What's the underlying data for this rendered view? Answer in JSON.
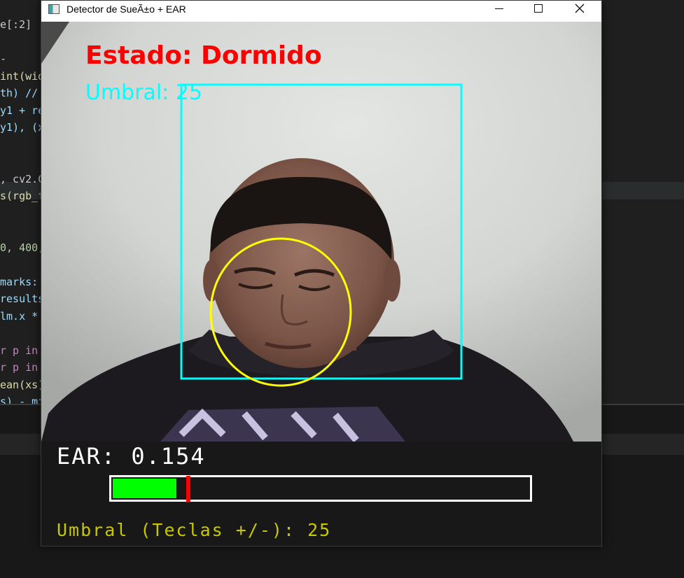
{
  "editor": {
    "lines": [
      {
        "text": "e[:2]",
        "color": "#cccccc"
      },
      {
        "text": "",
        "color": "#cccccc"
      },
      {
        "text": "-",
        "color": "#cccccc"
      },
      {
        "text": "int(wid",
        "color": "#dcdcaa"
      },
      {
        "text": "th) //",
        "color": "#9cdcfe"
      },
      {
        "text": "y1 + re",
        "color": "#9cdcfe"
      },
      {
        "text": "y1), (x",
        "color": "#9cdcfe"
      },
      {
        "text": "",
        "color": "#cccccc"
      },
      {
        "text": "",
        "color": "#cccccc"
      },
      {
        "text": ", cv2.C",
        "color": "#cccccc"
      },
      {
        "text": "s(rgb_f",
        "color": "#dcdcaa"
      },
      {
        "text": "",
        "color": "#cccccc"
      },
      {
        "text": "",
        "color": "#cccccc"
      },
      {
        "text": "0, 400,",
        "color": "#b5cea8"
      },
      {
        "text": "",
        "color": "#cccccc"
      },
      {
        "text": "marks:",
        "color": "#9cdcfe"
      },
      {
        "text": "results",
        "color": "#9cdcfe"
      },
      {
        "text": "lm.x *",
        "color": "#9cdcfe"
      },
      {
        "text": "",
        "color": "#cccccc"
      },
      {
        "text": "r p in",
        "color": "#c586c0"
      },
      {
        "text": "r p in",
        "color": "#c586c0"
      },
      {
        "text": "ean(xs)",
        "color": "#dcdcaa"
      },
      {
        "text": "s) - mi",
        "color": "#9cdcfe"
      }
    ]
  },
  "window": {
    "title": "Detector de SueÃ±o + EAR",
    "minimize_icon": "minimize-icon",
    "maximize_icon": "maximize-icon",
    "close_icon": "close-icon"
  },
  "overlay": {
    "estado": "Estado: Dormido",
    "estado_color": "#ff0000",
    "umbral": "Umbral: 25",
    "umbral_color": "#00ffff",
    "face_box_color": "#00ffff",
    "eye_circle_color": "#ffff00"
  },
  "info": {
    "ear_label": "EAR: 0.154",
    "ear_fill_fraction": 0.154,
    "threshold_fraction": 0.18,
    "fill_color": "#00ff00",
    "threshold_color": "#ff0000",
    "umbral_keys": "Umbral (Teclas +/-): 25"
  }
}
